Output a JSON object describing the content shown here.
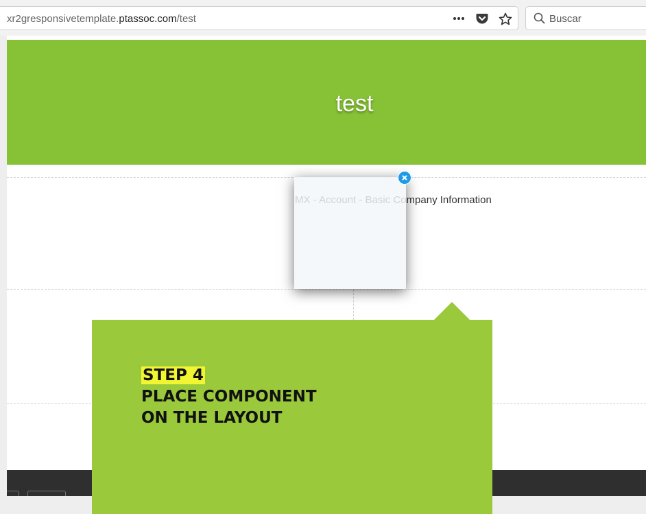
{
  "browser": {
    "url_prefix": "xr2gresponsivetemplate.",
    "url_domain": "ptassoc.com",
    "url_path": "/test",
    "search_placeholder": "Buscar",
    "icons": [
      "more-icon",
      "pocket-icon",
      "bookmark-star-icon",
      "search-icon"
    ]
  },
  "page": {
    "title": "test",
    "component_label": "MX - Account - Basic Company Information"
  },
  "tutorial": {
    "step": "STEP 4",
    "line1": "PLACE COMPONENT",
    "line2": "ON THE LAYOUT"
  },
  "colors": {
    "header_green": "#86c136",
    "callout_green": "#9ac93c",
    "step_highlight": "#f2f531",
    "close_button_blue": "#1e9be8",
    "footer_dark": "#2f2f2f"
  }
}
